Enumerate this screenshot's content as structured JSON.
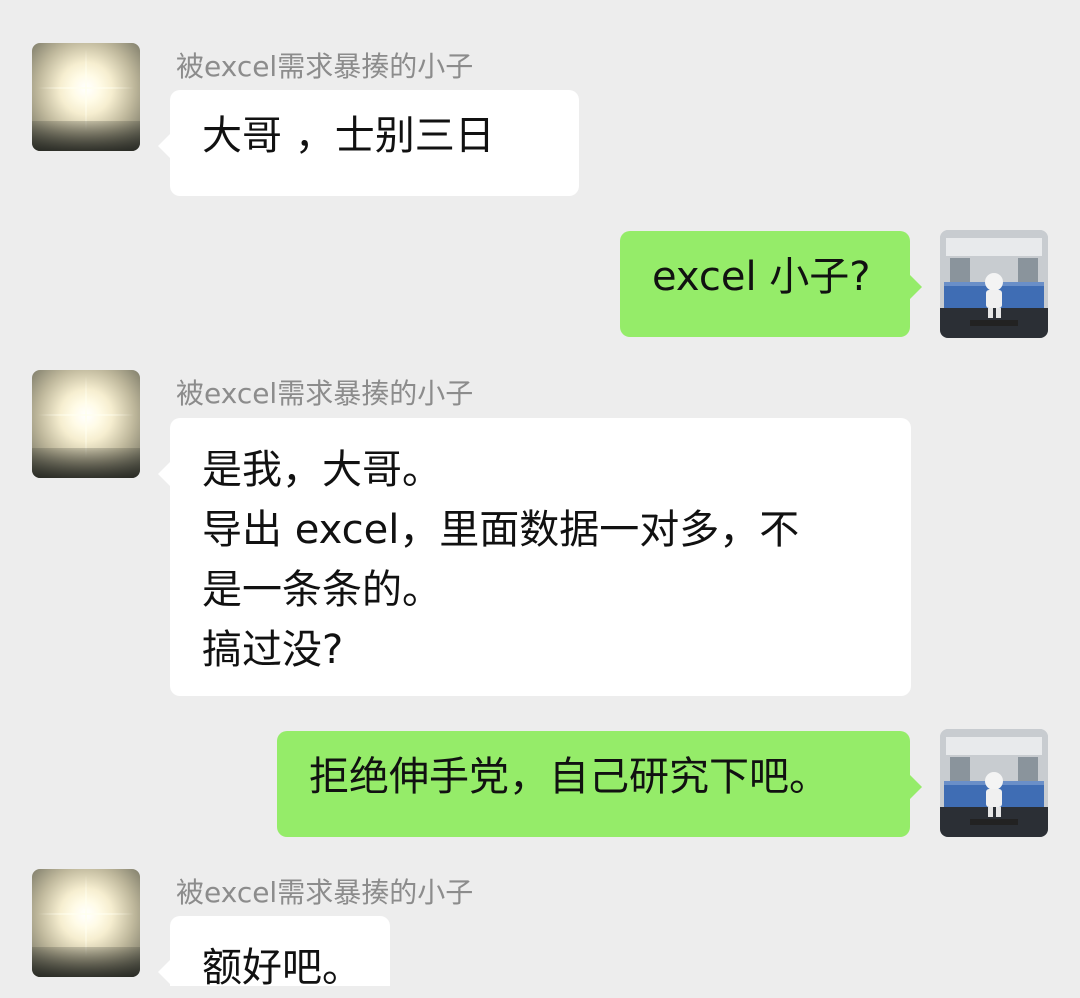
{
  "chat": {
    "sender_name": "被excel需求暴揍的小子",
    "messages": [
      {
        "side": "left",
        "lines": [
          "大哥 ，士别三日"
        ]
      },
      {
        "side": "right",
        "lines": [
          "excel 小子?"
        ]
      },
      {
        "side": "left",
        "lines": [
          "是我，大哥。",
          "导出 excel，里面数据一对多，不",
          "是一条条的。",
          "搞过没?"
        ]
      },
      {
        "side": "right",
        "lines": [
          "拒绝伸手党，自己研究下吧。"
        ]
      },
      {
        "side": "left",
        "lines": [
          "额好吧。"
        ]
      }
    ]
  },
  "colors": {
    "background": "#ededed",
    "incoming_bubble": "#ffffff",
    "outgoing_bubble": "#95ec69",
    "name_text": "#8c8c8c"
  },
  "icons": {
    "contact_avatar": "sunlight-photo-avatar",
    "my_avatar": "subway-astronaut-avatar"
  }
}
